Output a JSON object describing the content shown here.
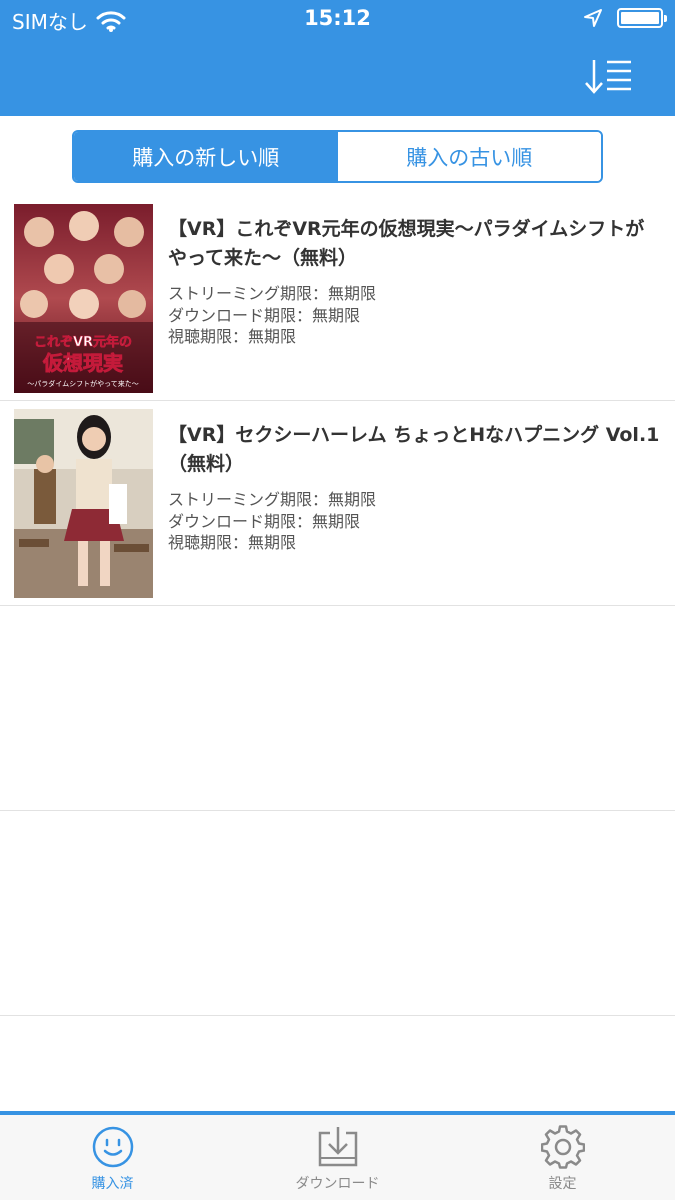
{
  "status_bar": {
    "carrier": "SIMなし",
    "time": "15:12"
  },
  "segment": {
    "newest_label": "購入の新しい順",
    "oldest_label": "購入の古い順"
  },
  "items": [
    {
      "title": "【VR】これぞVR元年の仮想現実〜パラダイムシフトがやって来た〜（無料）",
      "streaming": "ストリーミング期限：無期限",
      "download": "ダウンロード期限：無期限",
      "viewing": "視聴期限：無期限",
      "thumb_lines": [
        "これぞVR元年の",
        "仮想現実",
        "〜パラダイムシフトがやって来た〜"
      ]
    },
    {
      "title": "【VR】セクシーハーレム ちょっとHなハプニング Vol.1（無料）",
      "streaming": "ストリーミング期限：無期限",
      "download": "ダウンロード期限：無期限",
      "viewing": "視聴期限：無期限"
    }
  ],
  "tabbar": {
    "tabs": [
      {
        "label": "購入済",
        "icon": "smiley-icon"
      },
      {
        "label": "ダウンロード",
        "icon": "download-tray-icon"
      },
      {
        "label": "設定",
        "icon": "gear-icon"
      }
    ],
    "active_index": 0
  },
  "colors": {
    "accent": "#3793e3",
    "separator": "#e2e2e2"
  }
}
